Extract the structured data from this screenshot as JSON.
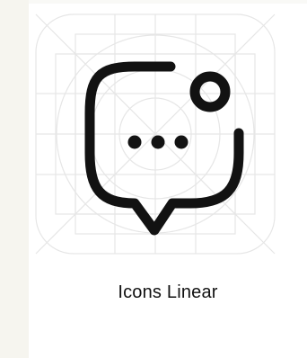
{
  "caption": "Icons Linear",
  "colors": {
    "background": "#f7f6f0",
    "card": "#ffffff",
    "icon_stroke": "#121212",
    "grid_lines": "#e6e6e6",
    "caption_text": "#111111"
  },
  "icon": {
    "name": "chat-bubble-notification-icon",
    "style": "linear"
  }
}
